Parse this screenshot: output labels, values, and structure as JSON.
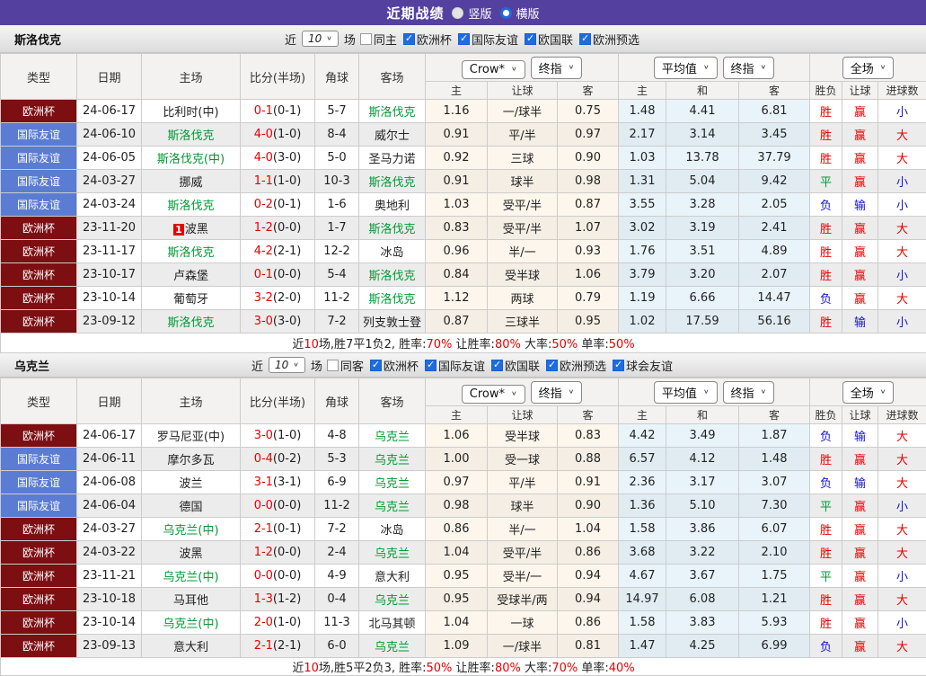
{
  "page": {
    "title": "近期战绩",
    "radios": [
      {
        "label": "竖版",
        "selected": false
      },
      {
        "label": "横版",
        "selected": true
      }
    ]
  },
  "colors": {
    "accent_purple": "#54419f",
    "score_red": "#e60000",
    "team_green": "#009933",
    "league_colors": {
      "欧洲杯": "#7d0e12",
      "国际友谊": "#5b7cd3"
    },
    "result_colors": {
      "胜": "#e60000",
      "平": "#009933",
      "负": "#1414cc",
      "赢": "#e60000",
      "输": "#1414cc",
      "大": "#e60000",
      "小": "#1414cc"
    }
  },
  "table_header": {
    "main_columns": [
      "类型",
      "日期",
      "主场",
      "比分(半场)",
      "角球",
      "客场"
    ],
    "sub_columns": [
      "主",
      "让球",
      "客",
      "主",
      "和",
      "客",
      "胜负",
      "让球",
      "进球数"
    ],
    "dropdowns": {
      "group1": [
        "Crow*",
        "终指"
      ],
      "group2": [
        "平均值",
        "终指"
      ],
      "group3": [
        "全场"
      ]
    }
  },
  "sections": [
    {
      "team": "斯洛伐克",
      "filter": {
        "prefix": "近",
        "count": "10",
        "suffix": "场",
        "same": {
          "label": "同主",
          "checked": false
        },
        "leagues": [
          {
            "label": "欧洲杯",
            "checked": true
          },
          {
            "label": "国际友谊",
            "checked": true
          },
          {
            "label": "欧国联",
            "checked": true
          },
          {
            "label": "欧洲预选",
            "checked": true
          }
        ]
      },
      "rows": [
        {
          "league": "欧洲杯",
          "date": "24-06-17",
          "home": "比利时(中)",
          "home_green": false,
          "home_badge": "",
          "score": "0-1",
          "half": "(0-1)",
          "corners": "5-7",
          "away": "斯洛伐克",
          "away_green": true,
          "handicap": [
            "1.16",
            "一/球半",
            "0.75"
          ],
          "europe": [
            "1.48",
            "4.41",
            "6.81"
          ],
          "results": [
            "胜",
            "赢",
            "小"
          ]
        },
        {
          "league": "国际友谊",
          "date": "24-06-10",
          "home": "斯洛伐克",
          "home_green": true,
          "home_badge": "",
          "score": "4-0",
          "half": "(1-0)",
          "corners": "8-4",
          "away": "威尔士",
          "away_green": false,
          "handicap": [
            "0.91",
            "平/半",
            "0.97"
          ],
          "europe": [
            "2.17",
            "3.14",
            "3.45"
          ],
          "results": [
            "胜",
            "赢",
            "大"
          ]
        },
        {
          "league": "国际友谊",
          "date": "24-06-05",
          "home": "斯洛伐克(中)",
          "home_green": true,
          "home_badge": "",
          "score": "4-0",
          "half": "(3-0)",
          "corners": "5-0",
          "away": "圣马力诺",
          "away_green": false,
          "handicap": [
            "0.92",
            "三球",
            "0.90"
          ],
          "europe": [
            "1.03",
            "13.78",
            "37.79"
          ],
          "results": [
            "胜",
            "赢",
            "大"
          ]
        },
        {
          "league": "国际友谊",
          "date": "24-03-27",
          "home": "挪威",
          "home_green": false,
          "home_badge": "",
          "score": "1-1",
          "half": "(1-0)",
          "corners": "10-3",
          "away": "斯洛伐克",
          "away_green": true,
          "handicap": [
            "0.91",
            "球半",
            "0.98"
          ],
          "europe": [
            "1.31",
            "5.04",
            "9.42"
          ],
          "results": [
            "平",
            "赢",
            "小"
          ]
        },
        {
          "league": "国际友谊",
          "date": "24-03-24",
          "home": "斯洛伐克",
          "home_green": true,
          "home_badge": "",
          "score": "0-2",
          "half": "(0-1)",
          "corners": "1-6",
          "away": "奥地利",
          "away_green": false,
          "handicap": [
            "1.03",
            "受平/半",
            "0.87"
          ],
          "europe": [
            "3.55",
            "3.28",
            "2.05"
          ],
          "results": [
            "负",
            "输",
            "小"
          ]
        },
        {
          "league": "欧洲杯",
          "date": "23-11-20",
          "home": "波黑",
          "home_green": false,
          "home_badge": "1",
          "score": "1-2",
          "half": "(0-0)",
          "corners": "1-7",
          "away": "斯洛伐克",
          "away_green": true,
          "handicap": [
            "0.83",
            "受平/半",
            "1.07"
          ],
          "europe": [
            "3.02",
            "3.19",
            "2.41"
          ],
          "results": [
            "胜",
            "赢",
            "大"
          ]
        },
        {
          "league": "欧洲杯",
          "date": "23-11-17",
          "home": "斯洛伐克",
          "home_green": true,
          "home_badge": "",
          "score": "4-2",
          "half": "(2-1)",
          "corners": "12-2",
          "away": "冰岛",
          "away_green": false,
          "handicap": [
            "0.96",
            "半/一",
            "0.93"
          ],
          "europe": [
            "1.76",
            "3.51",
            "4.89"
          ],
          "results": [
            "胜",
            "赢",
            "大"
          ]
        },
        {
          "league": "欧洲杯",
          "date": "23-10-17",
          "home": "卢森堡",
          "home_green": false,
          "home_badge": "",
          "score": "0-1",
          "half": "(0-0)",
          "corners": "5-4",
          "away": "斯洛伐克",
          "away_green": true,
          "handicap": [
            "0.84",
            "受半球",
            "1.06"
          ],
          "europe": [
            "3.79",
            "3.20",
            "2.07"
          ],
          "results": [
            "胜",
            "赢",
            "小"
          ]
        },
        {
          "league": "欧洲杯",
          "date": "23-10-14",
          "home": "葡萄牙",
          "home_green": false,
          "home_badge": "",
          "score": "3-2",
          "half": "(2-0)",
          "corners": "11-2",
          "away": "斯洛伐克",
          "away_green": true,
          "handicap": [
            "1.12",
            "两球",
            "0.79"
          ],
          "europe": [
            "1.19",
            "6.66",
            "14.47"
          ],
          "results": [
            "负",
            "赢",
            "大"
          ]
        },
        {
          "league": "欧洲杯",
          "date": "23-09-12",
          "home": "斯洛伐克",
          "home_green": true,
          "home_badge": "",
          "score": "3-0",
          "half": "(3-0)",
          "corners": "7-2",
          "away": "列支敦士登",
          "away_green": false,
          "handicap": [
            "0.87",
            "三球半",
            "0.95"
          ],
          "europe": [
            "1.02",
            "17.59",
            "56.16"
          ],
          "results": [
            "胜",
            "输",
            "小"
          ]
        }
      ],
      "summary": [
        {
          "t": "近",
          "red": false
        },
        {
          "t": "10",
          "red": true
        },
        {
          "t": "场,胜7平1负2, 胜率:",
          "red": false
        },
        {
          "t": "70%",
          "red": true
        },
        {
          "t": " 让胜率:",
          "red": false
        },
        {
          "t": "80%",
          "red": true
        },
        {
          "t": " 大率:",
          "red": false
        },
        {
          "t": "50%",
          "red": true
        },
        {
          "t": " 单率:",
          "red": false
        },
        {
          "t": "50%",
          "red": true
        }
      ]
    },
    {
      "team": "乌克兰",
      "filter": {
        "prefix": "近",
        "count": "10",
        "suffix": "场",
        "same": {
          "label": "同客",
          "checked": false
        },
        "leagues": [
          {
            "label": "欧洲杯",
            "checked": true
          },
          {
            "label": "国际友谊",
            "checked": true
          },
          {
            "label": "欧国联",
            "checked": true
          },
          {
            "label": "欧洲预选",
            "checked": true
          },
          {
            "label": "球会友谊",
            "checked": true
          }
        ]
      },
      "rows": [
        {
          "league": "欧洲杯",
          "date": "24-06-17",
          "home": "罗马尼亚(中)",
          "home_green": false,
          "home_badge": "",
          "score": "3-0",
          "half": "(1-0)",
          "corners": "4-8",
          "away": "乌克兰",
          "away_green": true,
          "handicap": [
            "1.06",
            "受半球",
            "0.83"
          ],
          "europe": [
            "4.42",
            "3.49",
            "1.87"
          ],
          "results": [
            "负",
            "输",
            "大"
          ]
        },
        {
          "league": "国际友谊",
          "date": "24-06-11",
          "home": "摩尔多瓦",
          "home_green": false,
          "home_badge": "",
          "score": "0-4",
          "half": "(0-2)",
          "corners": "5-3",
          "away": "乌克兰",
          "away_green": true,
          "handicap": [
            "1.00",
            "受一球",
            "0.88"
          ],
          "europe": [
            "6.57",
            "4.12",
            "1.48"
          ],
          "results": [
            "胜",
            "赢",
            "大"
          ]
        },
        {
          "league": "国际友谊",
          "date": "24-06-08",
          "home": "波兰",
          "home_green": false,
          "home_badge": "",
          "score": "3-1",
          "half": "(3-1)",
          "corners": "6-9",
          "away": "乌克兰",
          "away_green": true,
          "handicap": [
            "0.97",
            "平/半",
            "0.91"
          ],
          "europe": [
            "2.36",
            "3.17",
            "3.07"
          ],
          "results": [
            "负",
            "输",
            "大"
          ]
        },
        {
          "league": "国际友谊",
          "date": "24-06-04",
          "home": "德国",
          "home_green": false,
          "home_badge": "",
          "score": "0-0",
          "half": "(0-0)",
          "corners": "11-2",
          "away": "乌克兰",
          "away_green": true,
          "handicap": [
            "0.98",
            "球半",
            "0.90"
          ],
          "europe": [
            "1.36",
            "5.10",
            "7.30"
          ],
          "results": [
            "平",
            "赢",
            "小"
          ]
        },
        {
          "league": "欧洲杯",
          "date": "24-03-27",
          "home": "乌克兰(中)",
          "home_green": true,
          "home_badge": "",
          "score": "2-1",
          "half": "(0-1)",
          "corners": "7-2",
          "away": "冰岛",
          "away_green": false,
          "handicap": [
            "0.86",
            "半/一",
            "1.04"
          ],
          "europe": [
            "1.58",
            "3.86",
            "6.07"
          ],
          "results": [
            "胜",
            "赢",
            "大"
          ]
        },
        {
          "league": "欧洲杯",
          "date": "24-03-22",
          "home": "波黑",
          "home_green": false,
          "home_badge": "",
          "score": "1-2",
          "half": "(0-0)",
          "corners": "2-4",
          "away": "乌克兰",
          "away_green": true,
          "handicap": [
            "1.04",
            "受平/半",
            "0.86"
          ],
          "europe": [
            "3.68",
            "3.22",
            "2.10"
          ],
          "results": [
            "胜",
            "赢",
            "大"
          ]
        },
        {
          "league": "欧洲杯",
          "date": "23-11-21",
          "home": "乌克兰(中)",
          "home_green": true,
          "home_badge": "",
          "score": "0-0",
          "half": "(0-0)",
          "corners": "4-9",
          "away": "意大利",
          "away_green": false,
          "handicap": [
            "0.95",
            "受半/一",
            "0.94"
          ],
          "europe": [
            "4.67",
            "3.67",
            "1.75"
          ],
          "results": [
            "平",
            "赢",
            "小"
          ]
        },
        {
          "league": "欧洲杯",
          "date": "23-10-18",
          "home": "马耳他",
          "home_green": false,
          "home_badge": "",
          "score": "1-3",
          "half": "(1-2)",
          "corners": "0-4",
          "away": "乌克兰",
          "away_green": true,
          "handicap": [
            "0.95",
            "受球半/两",
            "0.94"
          ],
          "europe": [
            "14.97",
            "6.08",
            "1.21"
          ],
          "results": [
            "胜",
            "赢",
            "大"
          ]
        },
        {
          "league": "欧洲杯",
          "date": "23-10-14",
          "home": "乌克兰(中)",
          "home_green": true,
          "home_badge": "",
          "score": "2-0",
          "half": "(1-0)",
          "corners": "11-3",
          "away": "北马其顿",
          "away_green": false,
          "handicap": [
            "1.04",
            "一球",
            "0.86"
          ],
          "europe": [
            "1.58",
            "3.83",
            "5.93"
          ],
          "results": [
            "胜",
            "赢",
            "小"
          ]
        },
        {
          "league": "欧洲杯",
          "date": "23-09-13",
          "home": "意大利",
          "home_green": false,
          "home_badge": "",
          "score": "2-1",
          "half": "(2-1)",
          "corners": "6-0",
          "away": "乌克兰",
          "away_green": true,
          "handicap": [
            "1.09",
            "一/球半",
            "0.81"
          ],
          "europe": [
            "1.47",
            "4.25",
            "6.99"
          ],
          "results": [
            "负",
            "赢",
            "大"
          ]
        }
      ],
      "summary": [
        {
          "t": "近",
          "red": false
        },
        {
          "t": "10",
          "red": true
        },
        {
          "t": "场,胜5平2负3, 胜率:",
          "red": false
        },
        {
          "t": "50%",
          "red": true
        },
        {
          "t": " 让胜率:",
          "red": false
        },
        {
          "t": "80%",
          "red": true
        },
        {
          "t": " 大率:",
          "red": false
        },
        {
          "t": "70%",
          "red": true
        },
        {
          "t": " 单率:",
          "red": false
        },
        {
          "t": "40%",
          "red": true
        }
      ]
    }
  ]
}
